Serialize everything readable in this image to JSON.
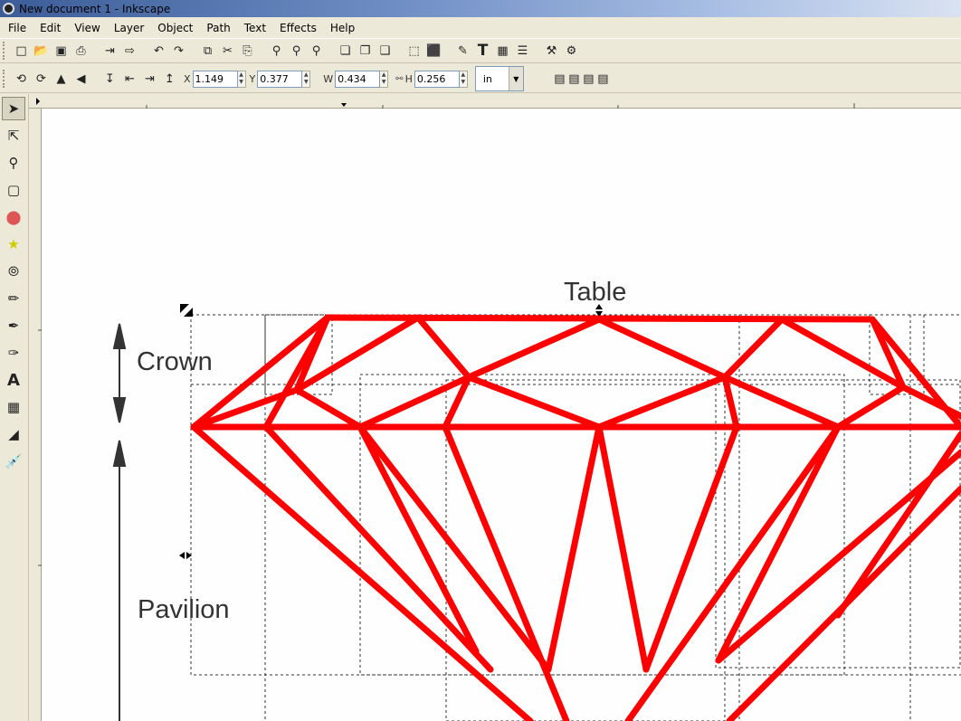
{
  "window": {
    "title": "New document 1 - Inkscape"
  },
  "menu": [
    {
      "label": "File"
    },
    {
      "label": "Edit"
    },
    {
      "label": "View"
    },
    {
      "label": "Layer"
    },
    {
      "label": "Object"
    },
    {
      "label": "Path"
    },
    {
      "label": "Text"
    },
    {
      "label": "Effects"
    },
    {
      "label": "Help"
    }
  ],
  "toolbar_icons": [
    "new-document-icon",
    "open-icon",
    "save-icon",
    "print-icon",
    "import-icon",
    "export-icon",
    "undo-icon",
    "redo-icon",
    "copy-icon",
    "cut-icon",
    "paste-icon",
    "zoom-selection-icon",
    "zoom-drawing-icon",
    "zoom-page-icon",
    "duplicate-icon",
    "clone-icon",
    "unlink-clone-icon",
    "group-icon",
    "ungroup-icon",
    "fill-stroke-icon",
    "text-font-icon",
    "xml-editor-icon",
    "align-icon",
    "preferences-icon",
    "document-properties-icon"
  ],
  "selector": {
    "x_label": "X",
    "x_value": "1.149",
    "y_label": "Y",
    "y_value": "0.377",
    "w_label": "W",
    "w_value": "0.434",
    "h_label": "H",
    "h_value": "0.256",
    "unit": "in"
  },
  "tools": [
    "selector-tool-icon",
    "node-tool-icon",
    "zoom-tool-icon",
    "rectangle-tool-icon",
    "ellipse-tool-icon",
    "star-tool-icon",
    "spiral-tool-icon",
    "pencil-tool-icon",
    "pen-tool-icon",
    "calligraphy-tool-icon",
    "text-tool-icon",
    "connector-tool-icon",
    "gradient-tool-icon",
    "dropper-tool-icon"
  ],
  "diagram": {
    "table_label": "Table",
    "crown_label": "Crown",
    "pavilion_label": "Pavilion",
    "line_color": "#ff0000"
  }
}
